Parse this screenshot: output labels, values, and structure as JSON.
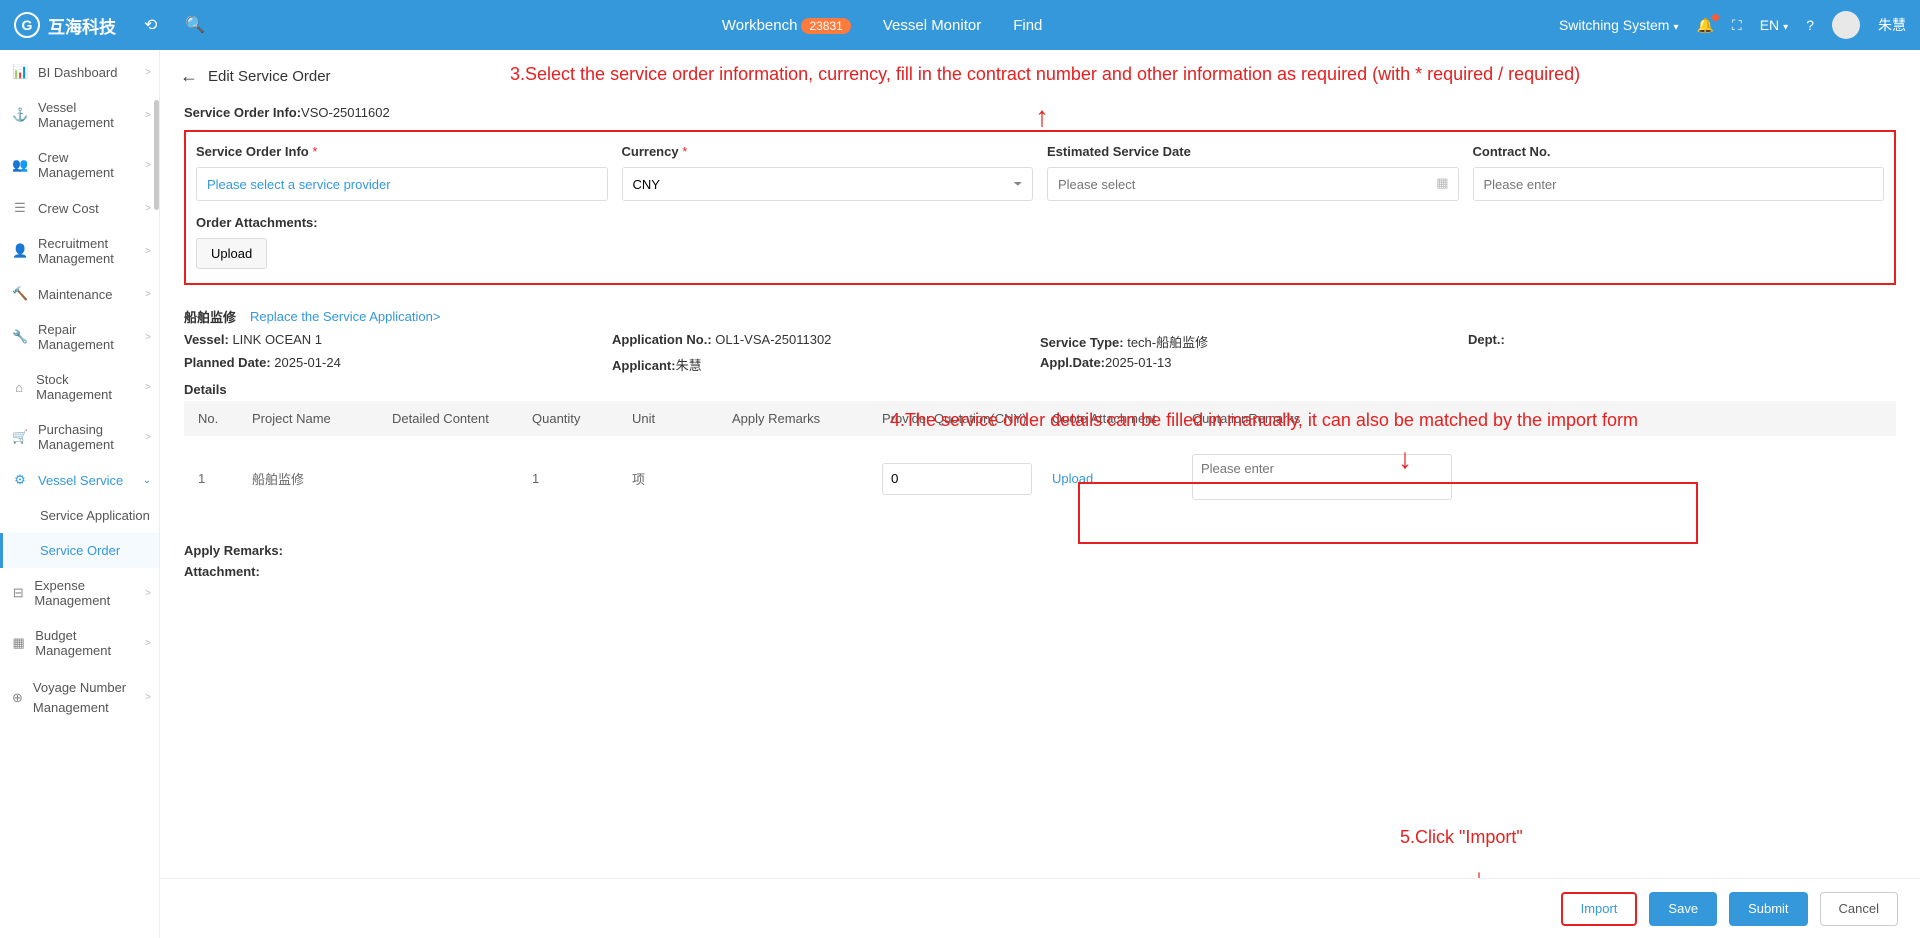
{
  "topbar": {
    "brand": "互海科技",
    "center": {
      "workbench": "Workbench",
      "badge": "23831",
      "vesselMonitor": "Vessel Monitor",
      "find": "Find"
    },
    "right": {
      "switch": "Switching System",
      "lang": "EN",
      "user": "朱慧"
    }
  },
  "sidebar": [
    {
      "icon": "📊",
      "label": "BI Dashboard",
      "chev": ">"
    },
    {
      "icon": "⚓",
      "label": "Vessel Management",
      "chev": ">"
    },
    {
      "icon": "👥",
      "label": "Crew Management",
      "chev": ">"
    },
    {
      "icon": "☰",
      "label": "Crew Cost",
      "chev": ">"
    },
    {
      "icon": "👤",
      "label": "Recruitment Management",
      "chev": ">"
    },
    {
      "icon": "🔨",
      "label": "Maintenance",
      "chev": ">"
    },
    {
      "icon": "🔧",
      "label": "Repair Management",
      "chev": ">"
    },
    {
      "icon": "⌂",
      "label": "Stock Management",
      "chev": ">"
    },
    {
      "icon": "🛒",
      "label": "Purchasing Management",
      "chev": ">"
    },
    {
      "icon": "⚙",
      "label": "Vessel Service",
      "chev": "⌄",
      "active": true,
      "subs": [
        {
          "label": "Service Application"
        },
        {
          "label": "Service Order",
          "active": true
        }
      ]
    },
    {
      "icon": "⊟",
      "label": "Expense Management",
      "chev": ">"
    },
    {
      "icon": "▦",
      "label": "Budget Management",
      "chev": ">"
    },
    {
      "icon": "⊕",
      "label": "Voyage Number Management",
      "chev": ">"
    }
  ],
  "page": {
    "title": "Edit Service Order"
  },
  "annot": {
    "a3": "3.Select the service order information, currency, fill in the contract number and other information as required (with * required / required)",
    "a4": "4.The service order details can be filled in manually, it can also be matched by the import form",
    "a5": "5.Click \"Import\""
  },
  "orderInfo": {
    "label": "Service Order Info:",
    "value": "VSO-25011602"
  },
  "form": {
    "f1": {
      "label": "Service Order Info",
      "ph": "Please select a service provider"
    },
    "f2": {
      "label": "Currency",
      "value": "CNY"
    },
    "f3": {
      "label": "Estimated Service Date",
      "ph": "Please select"
    },
    "f4": {
      "label": "Contract No.",
      "ph": "Please enter"
    },
    "attach": "Order Attachments:",
    "upload": "Upload"
  },
  "section": {
    "zh": "船舶监修",
    "replace": "Replace the Service Application>",
    "vessel": {
      "k": "Vessel: ",
      "v": "LINK OCEAN 1"
    },
    "appNo": {
      "k": "Application No.: ",
      "v": "OL1-VSA-25011302"
    },
    "svcType": {
      "k": "Service Type: ",
      "v": "tech-船舶监修"
    },
    "dept": {
      "k": "Dept.:",
      "v": ""
    },
    "planned": {
      "k": "Planned Date: ",
      "v": "2025-01-24"
    },
    "applicant": {
      "k": "Applicant:",
      "v": "朱慧"
    },
    "applDate": {
      "k": "Appl.Date:",
      "v": "2025-01-13"
    },
    "details": "Details"
  },
  "table": {
    "headers": {
      "no": "No.",
      "proj": "Project Name",
      "det": "Detailed Content",
      "qty": "Quantity",
      "unit": "Unit",
      "applyRem": "Apply Remarks",
      "quot": "Provider Quotation(CNY)",
      "quotAtt": "Quote Attachment",
      "quotRem": "QuotationRemarks"
    },
    "row": {
      "no": "1",
      "proj": "船舶监修",
      "det": "",
      "qty": "1",
      "unit": "项",
      "applyRem": "",
      "quotVal": "0",
      "upload": "Upload",
      "remPh": "Please enter"
    }
  },
  "below": {
    "applyRemarks": "Apply Remarks:",
    "attachment": "Attachment:"
  },
  "footer": {
    "import": "Import",
    "save": "Save",
    "submit": "Submit",
    "cancel": "Cancel"
  }
}
